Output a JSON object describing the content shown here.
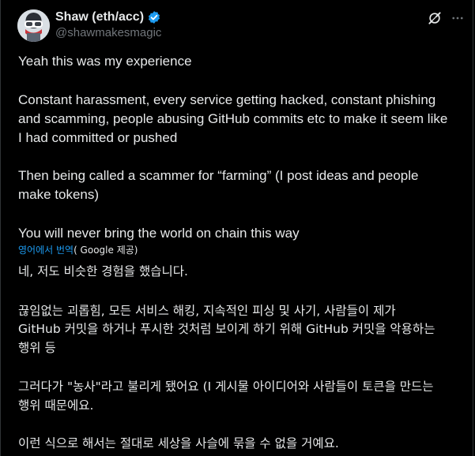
{
  "author": {
    "display_name": "Shaw (eth/acc)",
    "handle": "@shawmakesmagic"
  },
  "icons": {
    "verified": "verified-badge-icon",
    "grok": "grok-icon",
    "more": "more-icon"
  },
  "colors": {
    "background": "#000000",
    "text": "#e7e9ea",
    "muted": "#71767b",
    "link": "#1d9bf0",
    "border": "#2f3336"
  },
  "post": {
    "line1": "Yeah this was my experience",
    "line2": "Constant harassment, every service getting hacked, constant phishing",
    "line3": "and scamming, people abusing GitHub commits etc to make it seem like",
    "line4": "I had committed or pushed",
    "line5": "Then being called a scammer for “farming” (I post ideas and people",
    "line6": "make tokens)",
    "line7": "You will never bring the world on chain this way"
  },
  "translation_bar": {
    "link_text": "영어에서 번역",
    "provider": "( Google 제공)"
  },
  "translation": {
    "line1": "네, 저도 비슷한 경험을 했습니다.",
    "line2": "끊임없는 괴롭힘, 모든 서비스 해킹, 지속적인 피싱 및 사기, 사람들이 제가",
    "line3": "GitHub 커밋을 하거나 푸시한 것처럼 보이게 하기 위해 GitHub 커밋을 악용하는",
    "line4": "행위 등",
    "line5": "그러다가 \"농사\"라고 불리게 됐어요 (I 게시물 아이디어와 사람들이 토큰을 만드는",
    "line6": "행위 때문에요.",
    "line7": "이런 식으로 해서는 절대로 세상을 사슬에 묶을 수 없을 거예요."
  }
}
